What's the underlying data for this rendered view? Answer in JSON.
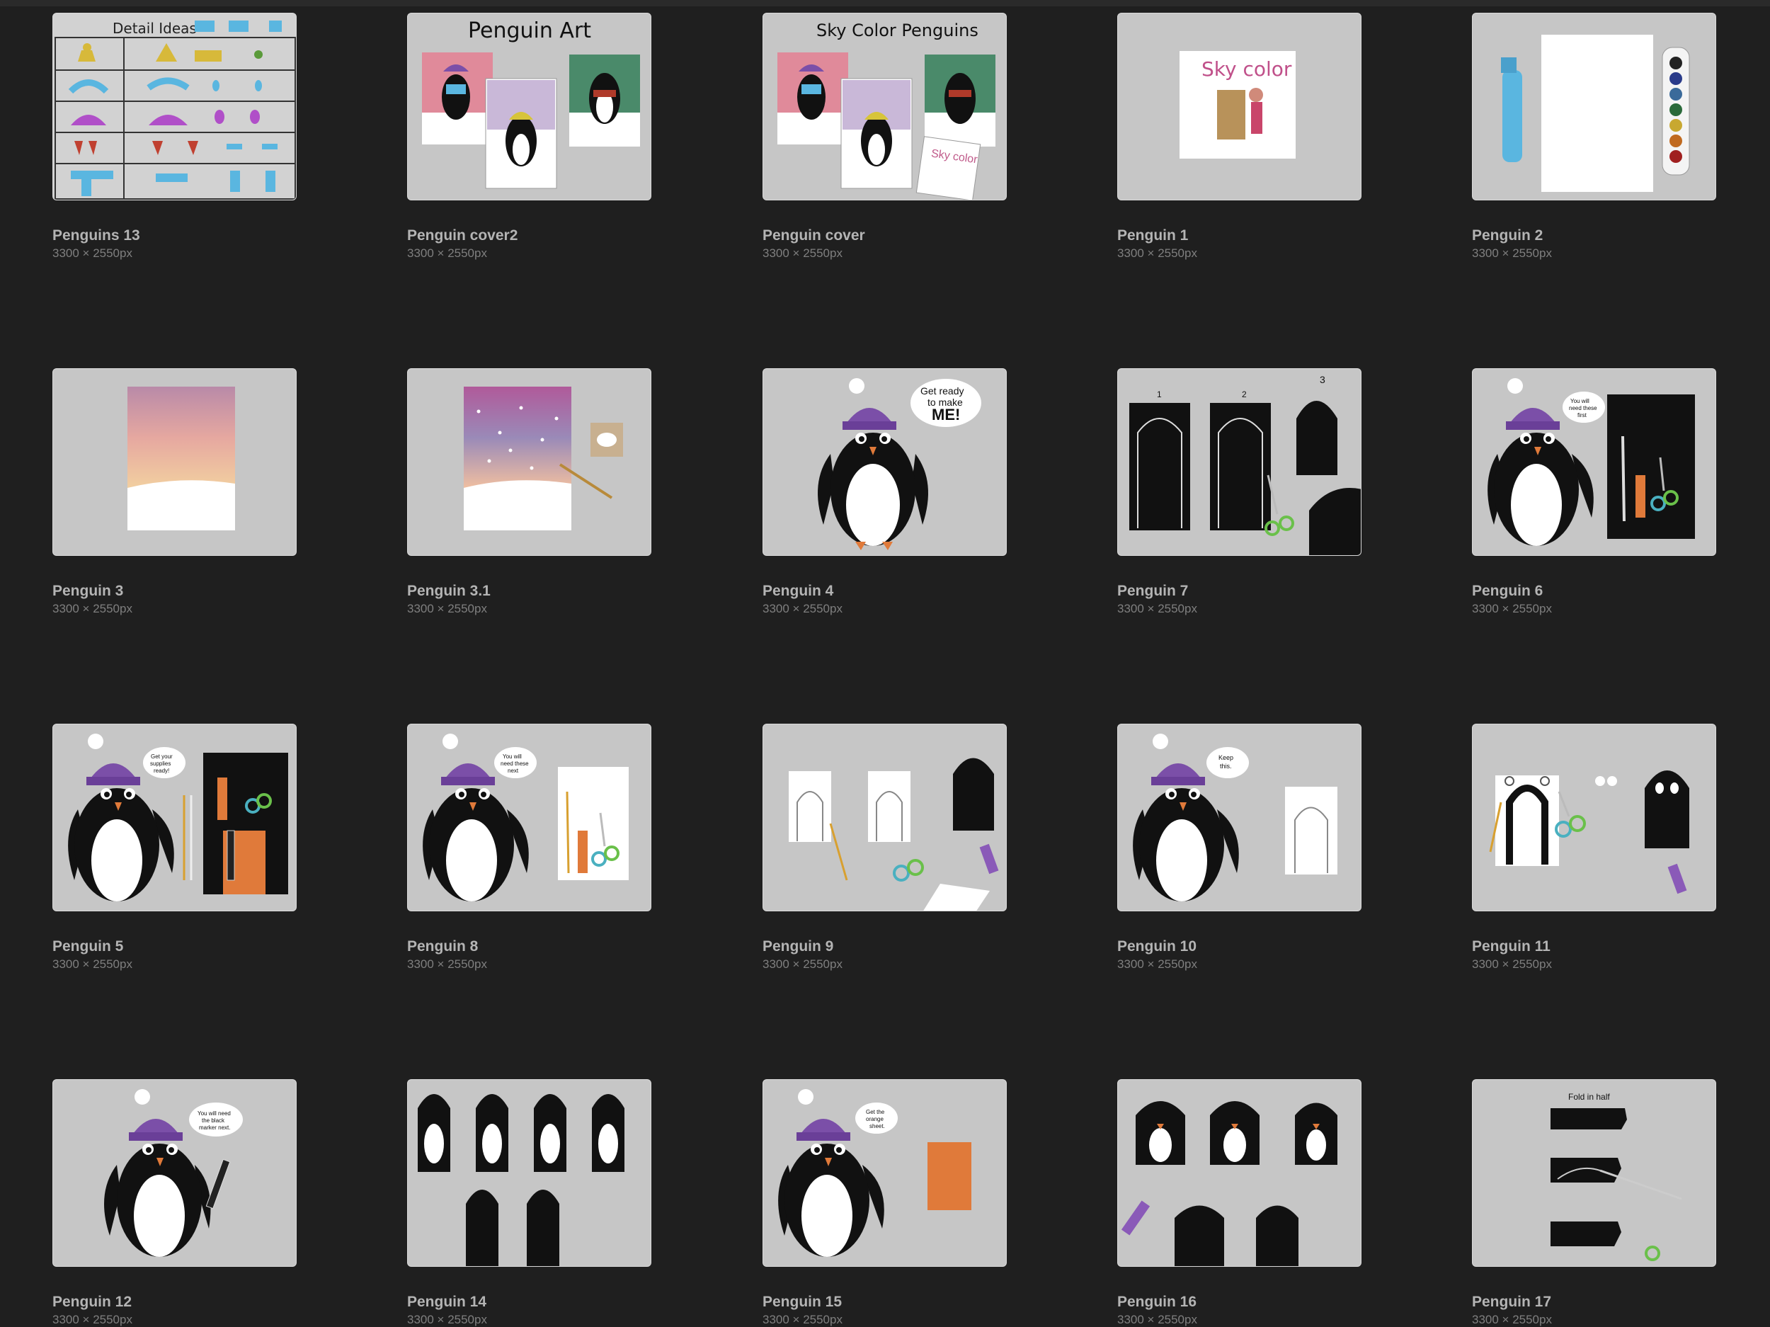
{
  "gallery": {
    "items": [
      {
        "name": "Penguins 13",
        "dims": "3300 × 2550px",
        "thumb_text": "Detail Ideas"
      },
      {
        "name": "Penguin cover2",
        "dims": "3300 × 2550px",
        "thumb_text": "Penguin Art"
      },
      {
        "name": "Penguin cover",
        "dims": "3300 × 2550px",
        "thumb_text": "Sky Color Penguins"
      },
      {
        "name": "Penguin 1",
        "dims": "3300 × 2550px",
        "thumb_text": "Sky color"
      },
      {
        "name": "Penguin 2",
        "dims": "3300 × 2550px"
      },
      {
        "name": "Penguin 3",
        "dims": "3300 × 2550px"
      },
      {
        "name": "Penguin 3.1",
        "dims": "3300 × 2550px"
      },
      {
        "name": "Penguin 4",
        "dims": "3300 × 2550px",
        "bubble": [
          "Get ready",
          "to make",
          "ME!"
        ]
      },
      {
        "name": "Penguin 7",
        "dims": "3300 × 2550px",
        "steps": [
          "1",
          "2",
          "3"
        ]
      },
      {
        "name": "Penguin 6",
        "dims": "3300 × 2550px",
        "bubble": [
          "You will",
          "need these",
          "first"
        ]
      },
      {
        "name": "Penguin 5",
        "dims": "3300 × 2550px",
        "bubble": [
          "Get your",
          "supplies",
          "ready!"
        ]
      },
      {
        "name": "Penguin 8",
        "dims": "3300 × 2550px",
        "bubble": [
          "You will",
          "need these",
          "next"
        ]
      },
      {
        "name": "Penguin 9",
        "dims": "3300 × 2550px"
      },
      {
        "name": "Penguin 10",
        "dims": "3300 × 2550px",
        "bubble": [
          "Keep",
          "this."
        ]
      },
      {
        "name": "Penguin 11",
        "dims": "3300 × 2550px"
      },
      {
        "name": "Penguin 12",
        "dims": "3300 × 2550px",
        "bubble": [
          "You will need",
          "the black",
          "marker next."
        ]
      },
      {
        "name": "Penguin 14",
        "dims": "3300 × 2550px"
      },
      {
        "name": "Penguin 15",
        "dims": "3300 × 2550px",
        "bubble": [
          "Get the",
          "orange",
          "sheet."
        ]
      },
      {
        "name": "Penguin 16",
        "dims": "3300 × 2550px"
      },
      {
        "name": "Penguin 17",
        "dims": "3300 × 2550px",
        "thumb_text": "Fold in half"
      }
    ]
  },
  "colors": {
    "background": "#1f1f1f",
    "thumb_bg": "#c6c6c6",
    "hat": "#7b4fa8",
    "beak": "#e07a3a",
    "scarf": "#5ab6e0"
  }
}
